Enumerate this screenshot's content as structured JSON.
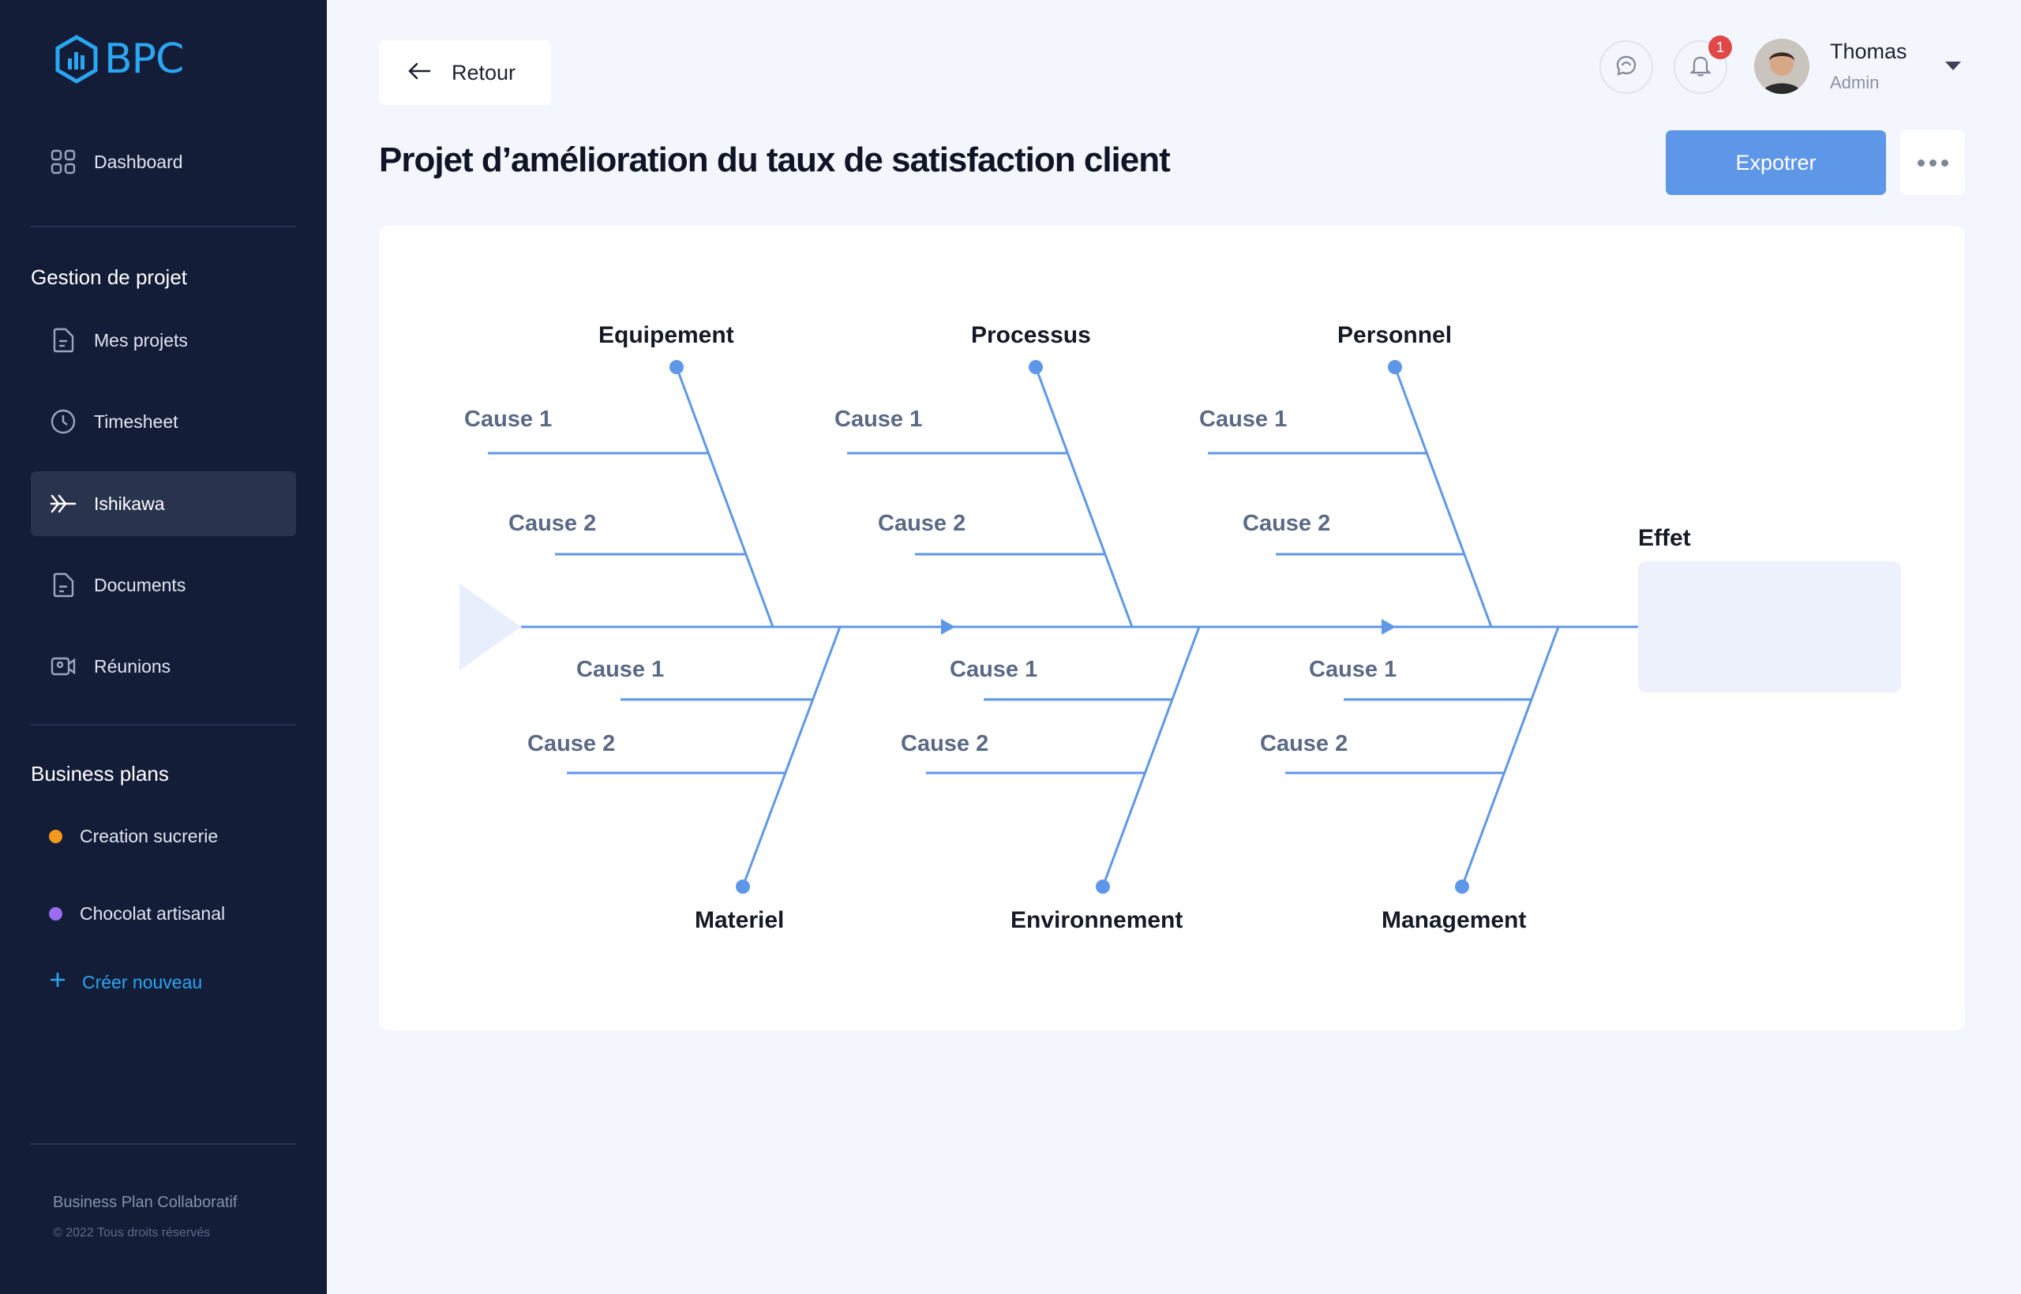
{
  "app": {
    "logo_text": "BPC"
  },
  "sidebar": {
    "nav_main": [
      {
        "label": "Dashboard",
        "icon": "grid-icon"
      }
    ],
    "section_project": "Gestion de projet",
    "project_items": [
      {
        "label": "Mes projets",
        "icon": "file-icon"
      },
      {
        "label": "Timesheet",
        "icon": "clock-icon"
      },
      {
        "label": "Ishikawa",
        "icon": "fishbone-icon",
        "active": true
      },
      {
        "label": "Documents",
        "icon": "document-icon"
      },
      {
        "label": "Réunions",
        "icon": "video-icon"
      }
    ],
    "section_business": "Business plans",
    "business_plans": [
      {
        "label": "Creation sucrerie",
        "color": "#f39a1e"
      },
      {
        "label": "Chocolat artisanal",
        "color": "#9b6cf0"
      }
    ],
    "create_new": "Créer nouveau",
    "footer_name": "Business Plan Collaboratif",
    "footer_copy": "© 2022 Tous droits réservés"
  },
  "header": {
    "back_label": "Retour",
    "notification_count": "1",
    "user_name": "Thomas",
    "user_role": "Admin"
  },
  "page": {
    "title": "Projet  d’amélioration du taux de satisfaction client",
    "export_label": "Expotrer"
  },
  "diagram": {
    "effect_label": "Effet",
    "top_categories": [
      {
        "name": "Equipement",
        "causes": [
          "Cause 1",
          "Cause 2"
        ]
      },
      {
        "name": "Processus",
        "causes": [
          "Cause 1",
          "Cause 2"
        ]
      },
      {
        "name": "Personnel",
        "causes": [
          "Cause 1",
          "Cause 2"
        ]
      }
    ],
    "bottom_categories": [
      {
        "name": "Materiel",
        "causes": [
          "Cause 1",
          "Cause 2"
        ]
      },
      {
        "name": "Environnement",
        "causes": [
          "Cause 1",
          "Cause 2"
        ]
      },
      {
        "name": "Management",
        "causes": [
          "Cause 1",
          "Cause 2"
        ]
      }
    ],
    "colors": {
      "line": "#5f97e8",
      "cause_text": "#5a6a86",
      "category_text": "#141a26",
      "effect_box": "#ecf1fb"
    }
  }
}
